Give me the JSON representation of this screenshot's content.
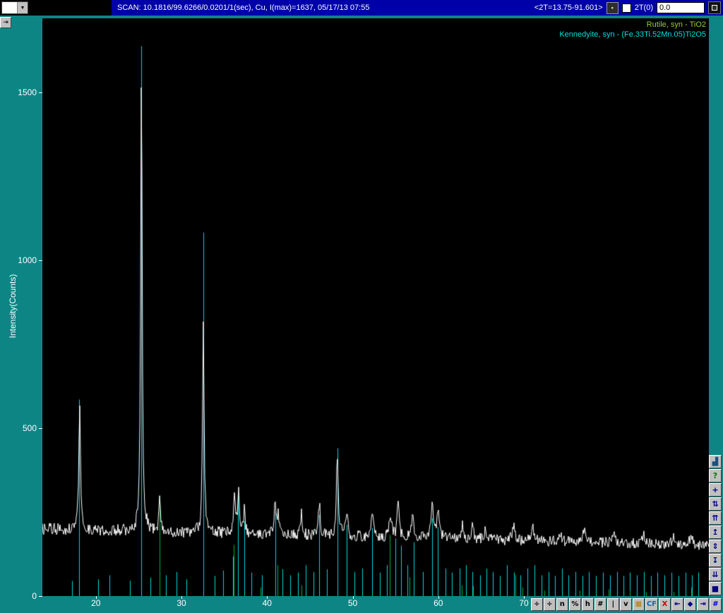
{
  "window": {
    "top_bar": {
      "preset_dropdown_value": "",
      "scan_info": "SCAN: 10.1816/99.6266/0.0201/1(sec), Cu, I(max)=1637, 05/17/13 07:55",
      "range_display": "<2T=13.75-91.601>",
      "chart_button_glyph": "▪",
      "two_theta_checkbox_label": "2T(0)",
      "two_theta_value": "0.0"
    },
    "side_button_glyph": "⇥"
  },
  "chart_data": {
    "type": "line",
    "title": "",
    "xlabel": "",
    "ylabel": "Intensity(Counts)",
    "x_range": [
      13.75,
      91.601
    ],
    "y_range": [
      0,
      1720
    ],
    "x_ticks": [
      20,
      30,
      40,
      50,
      60,
      70
    ],
    "y_ticks": [
      0,
      500,
      1000,
      1500
    ],
    "grid": false,
    "legend_position": "top-right",
    "legend": [
      {
        "label": "Rutile, syn - TiO2",
        "color": "#9acd32"
      },
      {
        "label": "Kennedyite, syn - (Fe.33Ti.52Mn.05)Ti2O5",
        "color": "#00e0e0"
      }
    ],
    "trace": {
      "name": "measured-scan",
      "color": "#ffffff",
      "baseline_start": 200,
      "baseline_end": 150,
      "noise_scale": 1.25,
      "peaks": [
        [
          18.1,
          395,
          0.22
        ],
        [
          25.32,
          1445,
          0.2
        ],
        [
          27.45,
          105,
          0.2
        ],
        [
          32.55,
          595,
          0.22
        ],
        [
          36.2,
          130,
          0.25
        ],
        [
          36.65,
          115,
          0.2
        ],
        [
          37.35,
          90,
          0.2
        ],
        [
          40.95,
          115,
          0.25
        ],
        [
          41.3,
          55,
          0.2
        ],
        [
          44.0,
          60,
          0.25
        ],
        [
          46.1,
          95,
          0.25
        ],
        [
          48.2,
          262,
          0.25
        ],
        [
          49.3,
          80,
          0.25
        ],
        [
          52.3,
          82,
          0.3
        ],
        [
          54.4,
          70,
          0.3
        ],
        [
          55.3,
          92,
          0.3
        ],
        [
          57.0,
          72,
          0.3
        ],
        [
          59.3,
          122,
          0.28
        ],
        [
          60.0,
          100,
          0.28
        ],
        [
          62.8,
          42,
          0.3
        ],
        [
          64.0,
          36,
          0.3
        ],
        [
          65.5,
          30,
          0.4
        ],
        [
          68.8,
          46,
          0.4
        ],
        [
          71.0,
          40,
          0.4
        ],
        [
          74.2,
          30,
          0.4
        ],
        [
          77.0,
          30,
          0.5
        ],
        [
          80.5,
          26,
          0.5
        ],
        [
          84.0,
          24,
          0.5
        ],
        [
          87.5,
          20,
          0.5
        ],
        [
          89.5,
          24,
          0.5
        ]
      ]
    },
    "stick_series": [
      {
        "name": "Kennedyite, syn - (Fe.33Ti.52Mn.05)Ti2O5",
        "color": "#00d9d9",
        "sticks": [
          [
            17.2,
            45
          ],
          [
            18.05,
            585
          ],
          [
            20.3,
            50
          ],
          [
            21.6,
            62
          ],
          [
            24.0,
            46
          ],
          [
            25.3,
            1637
          ],
          [
            26.35,
            55
          ],
          [
            28.2,
            62
          ],
          [
            29.45,
            72
          ],
          [
            30.6,
            50
          ],
          [
            32.55,
            1082
          ],
          [
            33.9,
            60
          ],
          [
            34.85,
            76
          ],
          [
            36.0,
            118
          ],
          [
            36.6,
            298
          ],
          [
            37.35,
            222
          ],
          [
            38.2,
            70
          ],
          [
            39.4,
            62
          ],
          [
            40.95,
            252
          ],
          [
            41.8,
            80
          ],
          [
            42.7,
            62
          ],
          [
            43.6,
            70
          ],
          [
            44.5,
            92
          ],
          [
            45.4,
            72
          ],
          [
            46.1,
            242
          ],
          [
            47.0,
            80
          ],
          [
            48.2,
            440
          ],
          [
            49.3,
            212
          ],
          [
            50.2,
            72
          ],
          [
            51.1,
            82
          ],
          [
            52.3,
            202
          ],
          [
            53.2,
            70
          ],
          [
            54.0,
            92
          ],
          [
            55.0,
            172
          ],
          [
            55.65,
            150
          ],
          [
            56.4,
            92
          ],
          [
            57.1,
            160
          ],
          [
            58.2,
            72
          ],
          [
            59.3,
            232
          ],
          [
            59.95,
            205
          ],
          [
            60.8,
            82
          ],
          [
            61.6,
            70
          ],
          [
            62.45,
            82
          ],
          [
            63.2,
            92
          ],
          [
            64.0,
            72
          ],
          [
            64.85,
            62
          ],
          [
            65.6,
            82
          ],
          [
            66.4,
            72
          ],
          [
            67.2,
            60
          ],
          [
            68.05,
            92
          ],
          [
            68.85,
            70
          ],
          [
            69.6,
            62
          ],
          [
            70.4,
            82
          ],
          [
            71.2,
            92
          ],
          [
            72.05,
            62
          ],
          [
            72.85,
            72
          ],
          [
            73.6,
            60
          ],
          [
            74.45,
            82
          ],
          [
            75.2,
            62
          ],
          [
            76.05,
            72
          ],
          [
            76.85,
            60
          ],
          [
            77.6,
            72
          ],
          [
            78.4,
            60
          ],
          [
            79.2,
            70
          ],
          [
            80.05,
            62
          ],
          [
            80.85,
            72
          ],
          [
            81.6,
            60
          ],
          [
            82.4,
            70
          ],
          [
            83.2,
            62
          ],
          [
            84.05,
            72
          ],
          [
            84.85,
            60
          ],
          [
            85.6,
            70
          ],
          [
            86.4,
            62
          ],
          [
            87.2,
            70
          ],
          [
            88.05,
            60
          ],
          [
            88.85,
            70
          ],
          [
            89.6,
            62
          ],
          [
            90.4,
            70
          ]
        ]
      },
      {
        "name": "Rutile, syn - TiO2",
        "color": "#00b43c",
        "sticks": [
          [
            27.45,
            300
          ],
          [
            36.1,
            152
          ],
          [
            39.2,
            26
          ],
          [
            41.25,
            92
          ],
          [
            44.05,
            32
          ],
          [
            54.35,
            182
          ],
          [
            56.65,
            56
          ],
          [
            62.75,
            32
          ],
          [
            64.05,
            30
          ],
          [
            69.0,
            62
          ],
          [
            69.8,
            26
          ],
          [
            72.4,
            16
          ],
          [
            76.55,
            16
          ],
          [
            79.85,
            20
          ],
          [
            82.35,
            16
          ],
          [
            84.25,
            12
          ],
          [
            87.45,
            12
          ],
          [
            89.55,
            26
          ]
        ]
      }
    ]
  },
  "right_toolbar": {
    "buttons": [
      {
        "name": "zoom-overview-button",
        "glyph": "▟",
        "color": "#205080"
      },
      {
        "name": "help-button",
        "glyph": "?",
        "color": "#007800"
      },
      {
        "name": "pan-button",
        "glyph": "+",
        "color": "#000080"
      },
      {
        "name": "swap-axes-button",
        "glyph": "⇅",
        "color": "#000080"
      },
      {
        "name": "page-up-fast-button",
        "glyph": "⇈",
        "color": "#000080"
      },
      {
        "name": "scroll-up-button",
        "glyph": "↥",
        "color": "#000080"
      },
      {
        "name": "fit-vertical-button",
        "glyph": "⇕",
        "color": "#000080"
      },
      {
        "name": "scroll-down-button",
        "glyph": "↧",
        "color": "#000080"
      },
      {
        "name": "page-down-fast-button",
        "glyph": "⇊",
        "color": "#000080"
      },
      {
        "name": "stop-button",
        "glyph": "■",
        "color": "#000080"
      }
    ]
  },
  "bottom_toolbar": {
    "buttons": [
      {
        "name": "divide-left-button",
        "glyph": "÷",
        "color": "#000000"
      },
      {
        "name": "divide-right-button",
        "glyph": "÷",
        "color": "#000000"
      },
      {
        "name": "normalize-button",
        "glyph": "n",
        "color": "#000000"
      },
      {
        "name": "percent-button",
        "glyph": "%",
        "color": "#000000"
      },
      {
        "name": "height-button",
        "glyph": "h",
        "color": "#000000"
      },
      {
        "name": "count-button",
        "glyph": "#",
        "color": "#000000"
      },
      {
        "name": "cursor-bar-button",
        "glyph": "|",
        "color": "#000000"
      },
      {
        "name": "v-marker-button",
        "glyph": "v",
        "color": "#000000"
      },
      {
        "name": "color-grid-button",
        "glyph": "▦",
        "color": "#b08000"
      },
      {
        "name": "cf-button",
        "glyph": "CF",
        "color": "#0070c0"
      },
      {
        "name": "delete-button",
        "glyph": "X",
        "color": "#cc0000"
      },
      {
        "name": "first-scan-button",
        "glyph": "⇤",
        "color": "#000080"
      },
      {
        "name": "marker-button",
        "glyph": "◆",
        "color": "#000080"
      },
      {
        "name": "last-scan-button",
        "glyph": "⇥",
        "color": "#000080"
      },
      {
        "name": "index-button",
        "glyph": "#",
        "color": "#0000cc"
      }
    ]
  }
}
